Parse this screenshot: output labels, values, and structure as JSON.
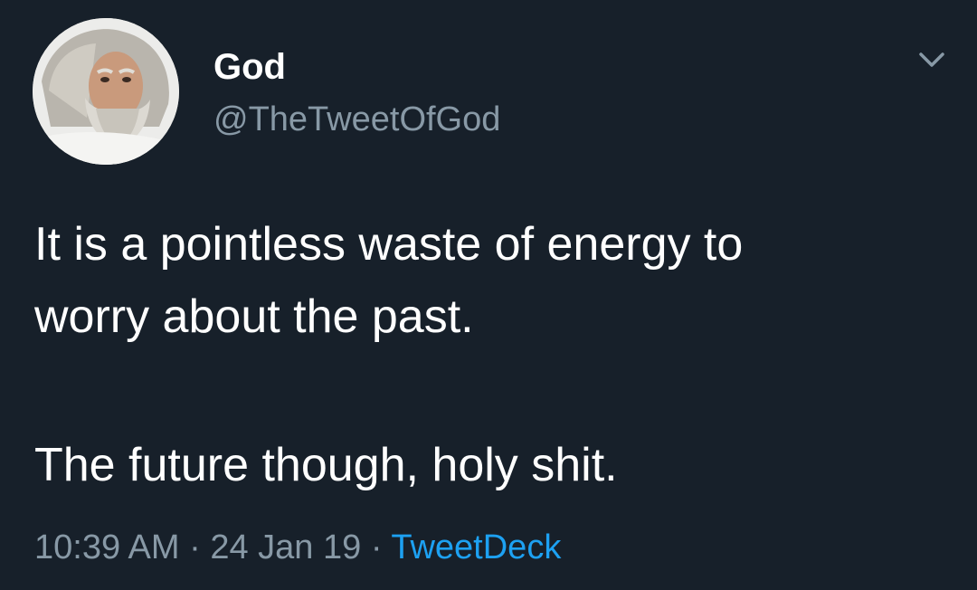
{
  "tweet": {
    "author": {
      "display_name": "God",
      "handle": "@TheTweetOfGod"
    },
    "text_lines": [
      "It is a pointless waste of energy to",
      "worry about the past.",
      "The future though, holy shit."
    ],
    "time": "10:39 AM",
    "separator": " · ",
    "date": "24 Jan 19",
    "source": "TweetDeck"
  },
  "colors": {
    "background": "#17202a",
    "primary_text": "#ffffff",
    "secondary_text": "#8899a6",
    "link": "#1da1f2"
  },
  "icons": {
    "menu": "chevron-down-icon"
  }
}
